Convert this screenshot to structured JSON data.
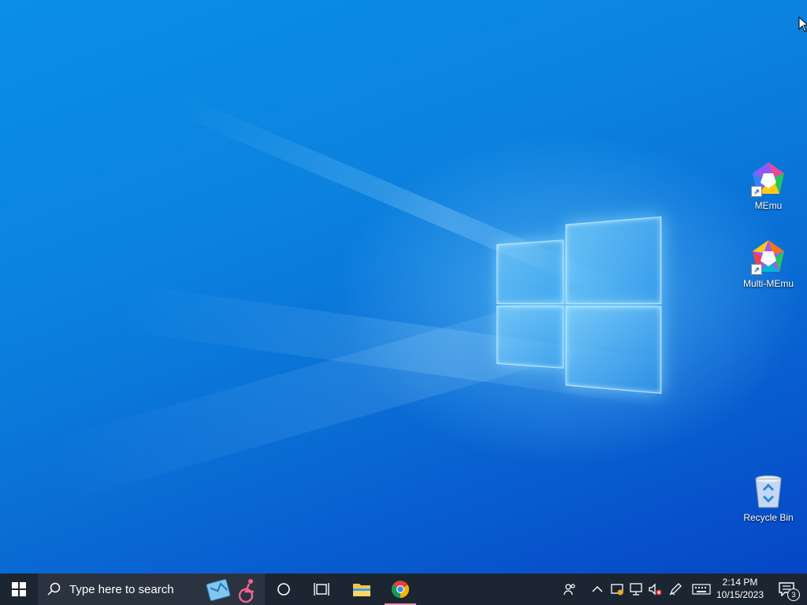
{
  "desktop": {
    "icons": [
      {
        "label": "MEmu",
        "icon": "memu-icon",
        "shortcut": true
      },
      {
        "label": "Multi-MEmu",
        "icon": "multi-memu-icon",
        "shortcut": true
      },
      {
        "label": "Recycle Bin",
        "icon": "recycle-bin-icon",
        "shortcut": false
      }
    ]
  },
  "taskbar": {
    "search_placeholder": "Type here to search",
    "pinned": [
      "file-explorer-icon",
      "chrome-icon"
    ],
    "tray_icons": [
      "people-icon",
      "chevron-up-icon",
      "security-icon",
      "network-icon",
      "volume-muted-icon",
      "pen-icon",
      "keyboard-icon"
    ],
    "clock": {
      "time": "2:14 PM",
      "date": "10/15/2023"
    },
    "notifications": {
      "count": "3"
    }
  },
  "colors": {
    "taskbar": "#1c2532",
    "desktop_accent": "#0a7fdf",
    "chrome_active": "#f48fb1"
  }
}
